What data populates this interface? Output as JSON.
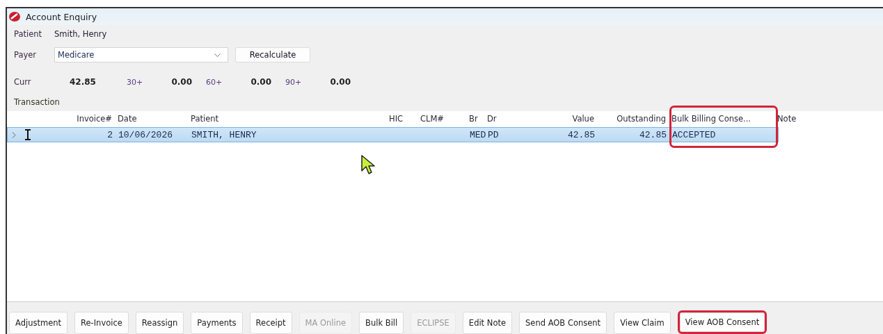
{
  "window": {
    "title": "Account Enquiry"
  },
  "patient": {
    "label": "Patient",
    "value": "Smith, Henry"
  },
  "payer": {
    "label": "Payer",
    "value": "Medicare",
    "button": "Recalculate"
  },
  "aging": [
    {
      "label": "Curr",
      "value": "42.85"
    },
    {
      "label": "30+",
      "value": "0.00"
    },
    {
      "label": "60+",
      "value": "0.00"
    },
    {
      "label": "90+",
      "value": "0.00"
    }
  ],
  "transaction_label": "Transaction",
  "table": {
    "columns": [
      {
        "label": "Invoice#",
        "highlighted": false
      },
      {
        "label": "Date",
        "highlighted": false
      },
      {
        "label": "Patient",
        "highlighted": false
      },
      {
        "label": "HIC",
        "highlighted": false
      },
      {
        "label": "CLM#",
        "highlighted": false
      },
      {
        "label": "Br",
        "highlighted": false
      },
      {
        "label": "Dr",
        "highlighted": false
      },
      {
        "label": "Value",
        "highlighted": false
      },
      {
        "label": "Outstanding",
        "highlighted": false
      },
      {
        "label": "Bulk Billing Conse...",
        "highlighted": true
      },
      {
        "label": "Note",
        "highlighted": false
      }
    ],
    "rows": [
      {
        "selected": true,
        "cells": [
          "2",
          "10/06/2026",
          "SMITH, HENRY",
          null,
          null,
          "MED",
          "PD",
          "42.85",
          "42.85",
          "ACCEPTED",
          null
        ]
      }
    ]
  },
  "buttons": [
    {
      "label": "Adjustment",
      "disabled": false,
      "highlighted": false
    },
    {
      "label": "Re-Invoice",
      "disabled": false,
      "highlighted": false
    },
    {
      "label": "Reassign",
      "disabled": false,
      "highlighted": false
    },
    {
      "label": "Payments",
      "disabled": false,
      "highlighted": false
    },
    {
      "label": "Receipt",
      "disabled": false,
      "highlighted": false
    },
    {
      "label": "MA Online",
      "disabled": true,
      "highlighted": false
    },
    {
      "label": "Bulk Bill",
      "disabled": false,
      "highlighted": false
    },
    {
      "label": "ECLIPSE",
      "disabled": true,
      "highlighted": false
    },
    {
      "label": "Edit Note",
      "disabled": false,
      "highlighted": false
    },
    {
      "label": "Send AOB Consent",
      "disabled": false,
      "highlighted": false
    },
    {
      "label": "View Claim",
      "disabled": false,
      "highlighted": false
    },
    {
      "label": "View AOB Consent",
      "disabled": false,
      "highlighted": true
    }
  ]
}
